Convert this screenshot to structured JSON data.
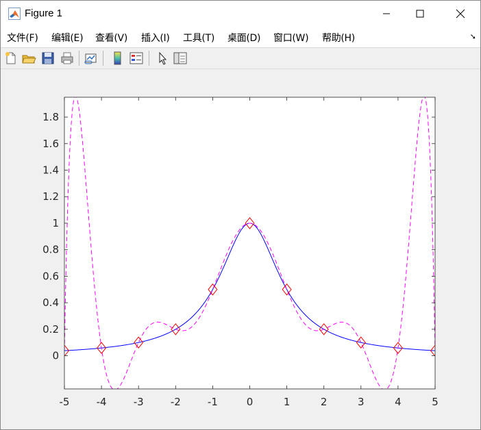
{
  "window": {
    "title": "Figure 1",
    "controls": {
      "minimize": "minimize",
      "maximize": "maximize",
      "close": "close"
    }
  },
  "menubar": {
    "items": [
      "文件(F)",
      "编辑(E)",
      "查看(V)",
      "插入(I)",
      "工具(T)",
      "桌面(D)",
      "窗口(W)",
      "帮助(H)"
    ]
  },
  "toolbar": {
    "icons": [
      "new-figure-icon",
      "open-file-icon",
      "save-icon",
      "print-icon",
      "link-plot-icon",
      "colorbar-icon",
      "legend-icon",
      "edit-plot-arrow-icon",
      "property-inspector-icon"
    ]
  },
  "colors": {
    "runge_curve": "#0000ff",
    "interp_curve": "#ff00ff",
    "markers": "#ff0000"
  },
  "chart_data": {
    "type": "line",
    "title": "",
    "xlabel": "",
    "ylabel": "",
    "xlim": [
      -5,
      5
    ],
    "ylim": [
      -0.25,
      1.95
    ],
    "xticks": [
      "-5",
      "-4",
      "-3",
      "-2",
      "-1",
      "0",
      "1",
      "2",
      "3",
      "4",
      "5"
    ],
    "yticks": [
      "0",
      "0.2",
      "0.4",
      "0.6",
      "0.8",
      "1",
      "1.2",
      "1.4",
      "1.6",
      "1.8"
    ],
    "ytick_values": [
      0,
      0.2,
      0.4,
      0.6,
      0.8,
      1,
      1.2,
      1.4,
      1.6,
      1.8
    ],
    "grid": false,
    "series": [
      {
        "style": "solid",
        "color": "#0000ff",
        "function": "1/(1+x^2)"
      },
      {
        "style": "dashed",
        "color": "#ff00ff",
        "description_source": "degree-10 interpolating polynomial through markers"
      },
      {
        "style": "diamond-markers",
        "color": "#ff0000",
        "x": [
          -5,
          -4,
          -3,
          -2,
          -1,
          0,
          1,
          2,
          3,
          4,
          5
        ],
        "y": [
          0.0385,
          0.0588,
          0.1,
          0.2,
          0.5,
          1,
          0.5,
          0.2,
          0.1,
          0.0588,
          0.0385
        ]
      }
    ]
  }
}
